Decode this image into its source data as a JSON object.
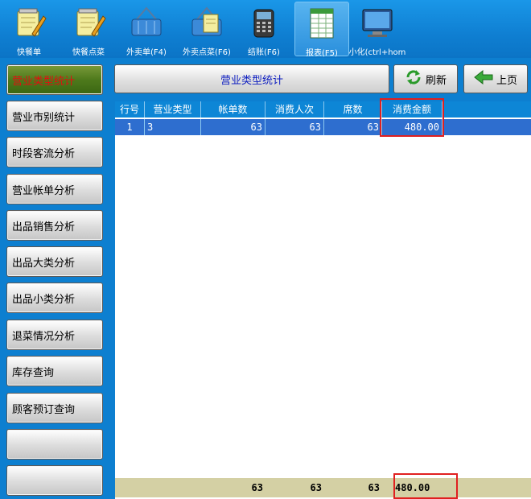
{
  "toolbar": {
    "items": [
      {
        "label": "快餐单",
        "icon": "notepad-pen-icon"
      },
      {
        "label": "快餐点菜",
        "icon": "notepad-pen-icon"
      },
      {
        "label": "外卖单(F4)",
        "icon": "basket-icon"
      },
      {
        "label": "外卖点菜(F6)",
        "icon": "basket-notepad-icon"
      },
      {
        "label": "结账(F6)",
        "icon": "pos-terminal-icon"
      },
      {
        "label": "报表(F5)",
        "icon": "spreadsheet-icon"
      },
      {
        "label": "小化(ctrl+hom",
        "icon": "monitor-icon"
      }
    ]
  },
  "sidebar": {
    "items": [
      {
        "label": "营业类型统计",
        "active": true
      },
      {
        "label": "营业市别统计"
      },
      {
        "label": "时段客流分析"
      },
      {
        "label": "营业帐单分析"
      },
      {
        "label": "出品销售分析"
      },
      {
        "label": "出品大类分析"
      },
      {
        "label": "出品小类分析"
      },
      {
        "label": "退菜情况分析"
      },
      {
        "label": "库存查询"
      },
      {
        "label": "顾客预订查询"
      },
      {
        "label": ""
      },
      {
        "label": ""
      }
    ]
  },
  "header": {
    "title": "营业类型统计",
    "refresh_label": "刷新",
    "back_label": "上页"
  },
  "grid": {
    "columns": [
      "行号",
      "营业类型",
      "帐单数",
      "消费人次",
      "席数",
      "消费金额"
    ],
    "rows": [
      [
        "1",
        "3",
        "63",
        "63",
        "63",
        "480.00"
      ]
    ],
    "totals": [
      "",
      "",
      "63",
      "63",
      "63",
      "480.00"
    ]
  },
  "colors": {
    "background": "#0d7fd0",
    "selected_row": "#2e6ecf",
    "footer": "#d4d0a4",
    "highlight": "#e02020",
    "active_sidebar": "#4e7a1c"
  }
}
